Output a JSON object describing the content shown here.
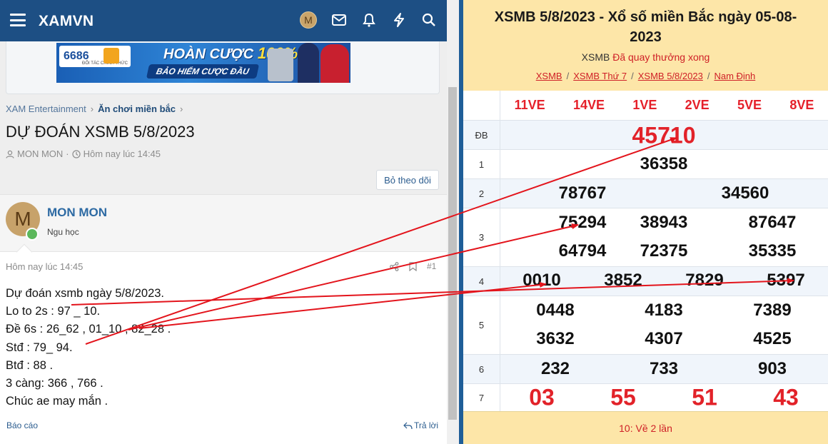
{
  "nav": {
    "brand": "XAMVN",
    "avatar_letter": "M"
  },
  "banner": {
    "logo_text": "6686",
    "logo_sub": "ĐỐI TÁC CHÍNH THỨC",
    "headline_a": "HOÀN CƯỢC",
    "headline_b": "100%",
    "subline": "BẢO HIỂM CƯỢC ĐẦU"
  },
  "breadcrumb": {
    "items": [
      "XAM Entertainment",
      "Ăn chơi miền bắc"
    ]
  },
  "thread": {
    "title": "DỰ ĐOÁN XSMB 5/8/2023",
    "author": "MON MON",
    "time": "Hôm nay lúc 14:45",
    "unfollow_label": "Bỏ theo dõi"
  },
  "post": {
    "avatar_letter": "M",
    "username": "MON MON",
    "user_title": "Ngu học",
    "date": "Hôm nay lúc 14:45",
    "post_number": "#1",
    "lines": [
      "Dự đoán xsmb ngày 5/8/2023.",
      "Lo to 2s : 97 _ 10.",
      "Đề 6s : 26_62 , 01_10 , 82_28 .",
      "Stđ : 79_ 94.",
      "Btđ : 88 .",
      "3 càng: 366 , 766 .",
      "Chúc ae may mắn ."
    ],
    "report_label": "Báo cáo",
    "reply_label": "Trả lời"
  },
  "results": {
    "title_line1": "XSMB 5/8/2023 - Xổ số miền Bắc ngày 05-08-",
    "title_line2": "2023",
    "status_a": "XSMB",
    "status_b": "Đã quay thưởng xong",
    "links": [
      "XSMB",
      "XSMB Thứ 7",
      "XSMB 5/8/2023",
      "Nam Định"
    ],
    "codes": [
      "11VE",
      "14VE",
      "1VE",
      "2VE",
      "5VE",
      "8VE"
    ],
    "prizes": [
      {
        "label": "ĐB",
        "numbers": [
          "45710"
        ]
      },
      {
        "label": "1",
        "numbers": [
          "36358"
        ]
      },
      {
        "label": "2",
        "numbers": [
          "78767",
          "34560"
        ]
      },
      {
        "label": "3",
        "numbers": [
          "75294",
          "38943",
          "87647",
          "64794",
          "72375",
          "35335"
        ]
      },
      {
        "label": "4",
        "numbers": [
          "0010",
          "3852",
          "7829",
          "5397"
        ]
      },
      {
        "label": "5",
        "numbers": [
          "0448",
          "4183",
          "7389",
          "3632",
          "4307",
          "4525"
        ]
      },
      {
        "label": "6",
        "numbers": [
          "232",
          "733",
          "903"
        ]
      },
      {
        "label": "7",
        "numbers": [
          "03",
          "55",
          "51",
          "43"
        ]
      }
    ],
    "footer": "10: Về 2 lần"
  },
  "colors": {
    "nav": "#1d4f84",
    "accent_red": "#e22229",
    "header_yellow": "#fde6a8",
    "alt_row": "#f0f5fb"
  }
}
